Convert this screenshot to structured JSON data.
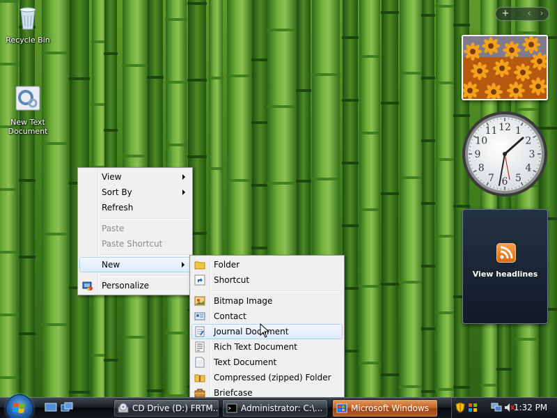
{
  "desktop": {
    "icons": [
      {
        "label": "Recycle Bin",
        "icon": "recycle-bin-icon"
      },
      {
        "label": "New Text Document",
        "icon": "text-document-icon"
      }
    ]
  },
  "gadgets": {
    "feed_label": "View headlines",
    "clock_hour_numerals": [
      "12",
      "1",
      "2",
      "3",
      "4",
      "5",
      "6",
      "7",
      "8",
      "9",
      "10",
      "11"
    ]
  },
  "context_menu": {
    "items": [
      {
        "label": "View",
        "submenu": true
      },
      {
        "label": "Sort By",
        "submenu": true
      },
      {
        "label": "Refresh"
      },
      {
        "label": "Paste",
        "disabled": true
      },
      {
        "label": "Paste Shortcut",
        "disabled": true
      },
      {
        "label": "New",
        "submenu": true,
        "highlighted": true
      },
      {
        "label": "Personalize",
        "icon": "personalize-icon"
      }
    ]
  },
  "new_submenu": {
    "items": [
      {
        "label": "Folder",
        "icon": "folder-icon"
      },
      {
        "label": "Shortcut",
        "icon": "shortcut-icon"
      },
      {
        "label": "Bitmap Image",
        "icon": "bitmap-image-icon"
      },
      {
        "label": "Contact",
        "icon": "contact-icon"
      },
      {
        "label": "Journal Document",
        "icon": "journal-document-icon",
        "highlighted": true
      },
      {
        "label": "Rich Text Document",
        "icon": "rich-text-document-icon"
      },
      {
        "label": "Text Document",
        "icon": "text-document-icon"
      },
      {
        "label": "Compressed (zipped) Folder",
        "icon": "zipped-folder-icon"
      },
      {
        "label": "Briefcase",
        "icon": "briefcase-icon"
      }
    ]
  },
  "taskbar": {
    "tasks": [
      {
        "label": "CD Drive (D:) FRTM...",
        "icon": "cd-drive-icon"
      },
      {
        "label": "Administrator: C:\\...",
        "icon": "command-prompt-icon"
      },
      {
        "label": "Microsoft Windows",
        "icon": "windows-setup-icon",
        "active": true
      }
    ],
    "clock": "1:32 PM"
  },
  "colors": {
    "menu_background": "#f0f0f0",
    "menu_highlight": "#dcebfc",
    "active_task": "#c0622a",
    "feed_accent": "#e0690c"
  }
}
